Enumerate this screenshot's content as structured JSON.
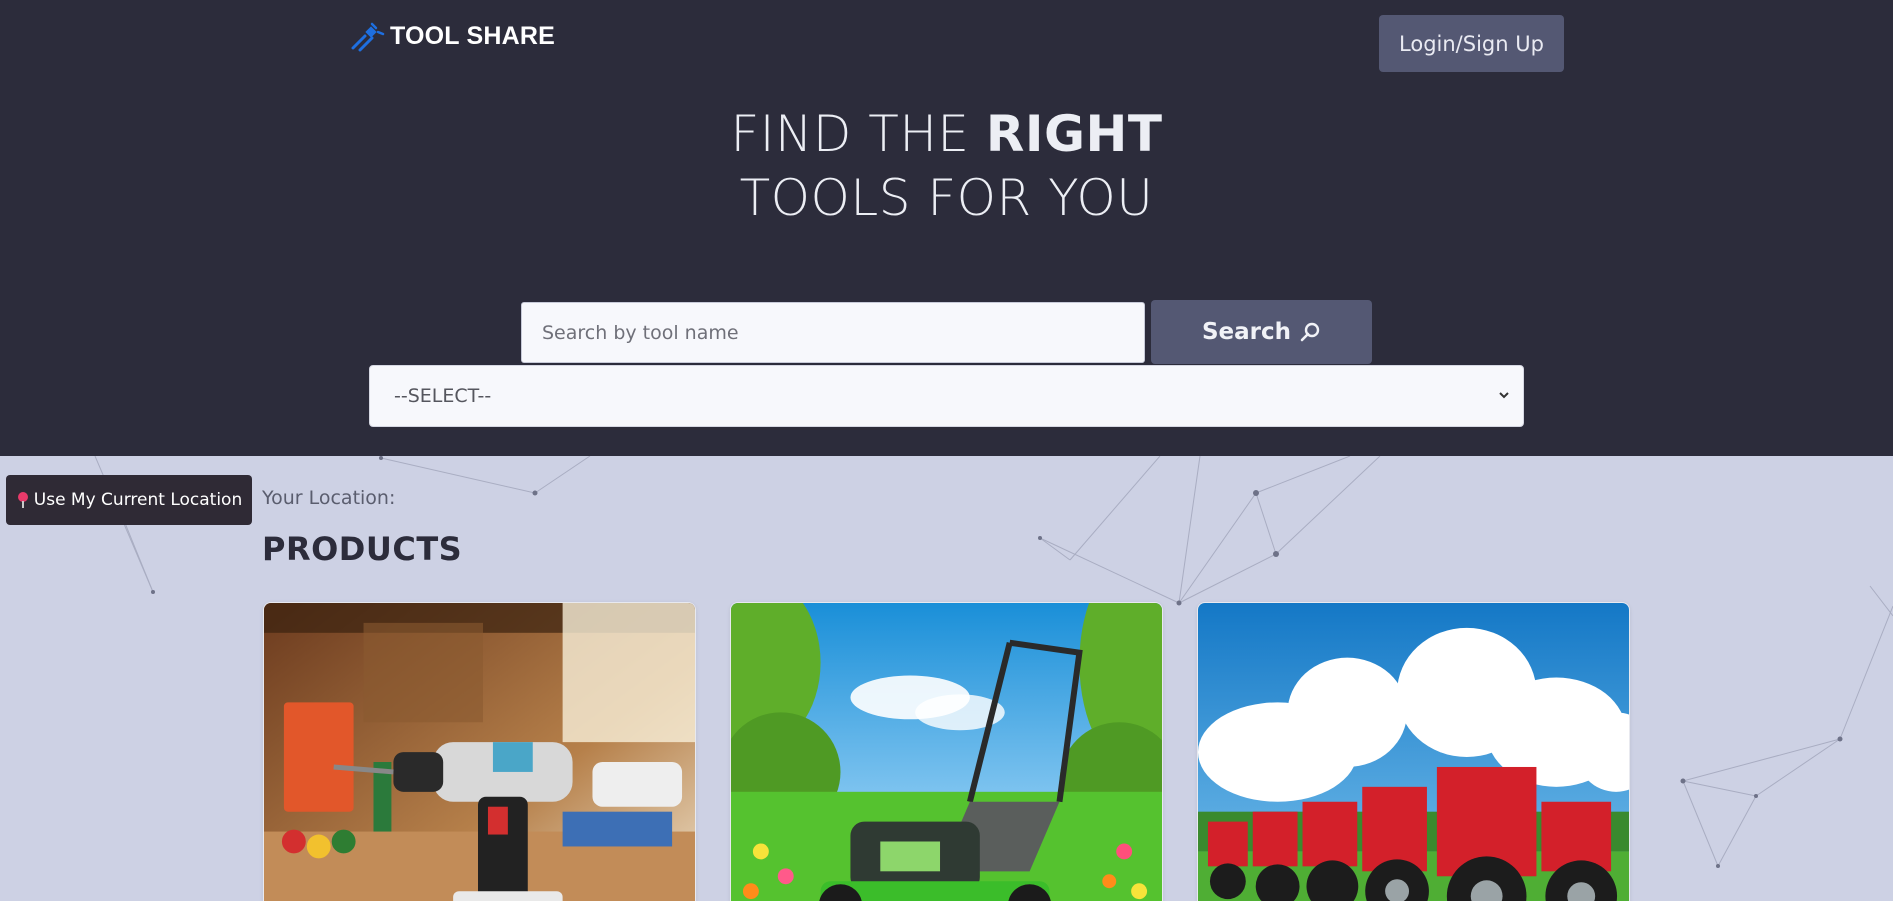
{
  "header": {
    "brand": "TOOL SHARE",
    "login_label": "Login/Sign Up"
  },
  "hero": {
    "line1_light": "FIND THE ",
    "line1_bold": "RIGHT",
    "line2": "TOOLS FOR YOU"
  },
  "search": {
    "placeholder": "Search by tool name",
    "button_label": "Search",
    "select_value": "--SELECT--"
  },
  "location": {
    "button_label": "Use My Current Location",
    "your_location_label": "Your Location:"
  },
  "products": {
    "title": "PRODUCTS",
    "items": [
      {
        "image": "cordless-drill-workshop-image"
      },
      {
        "image": "lawn-mower-garden-image"
      },
      {
        "image": "red-tractors-field-image"
      }
    ]
  },
  "colors": {
    "header_bg": "#2c2c3b",
    "accent_button": "#545873",
    "page_bg": "#cdd1e4",
    "brand_icon": "#1e6fe0"
  }
}
